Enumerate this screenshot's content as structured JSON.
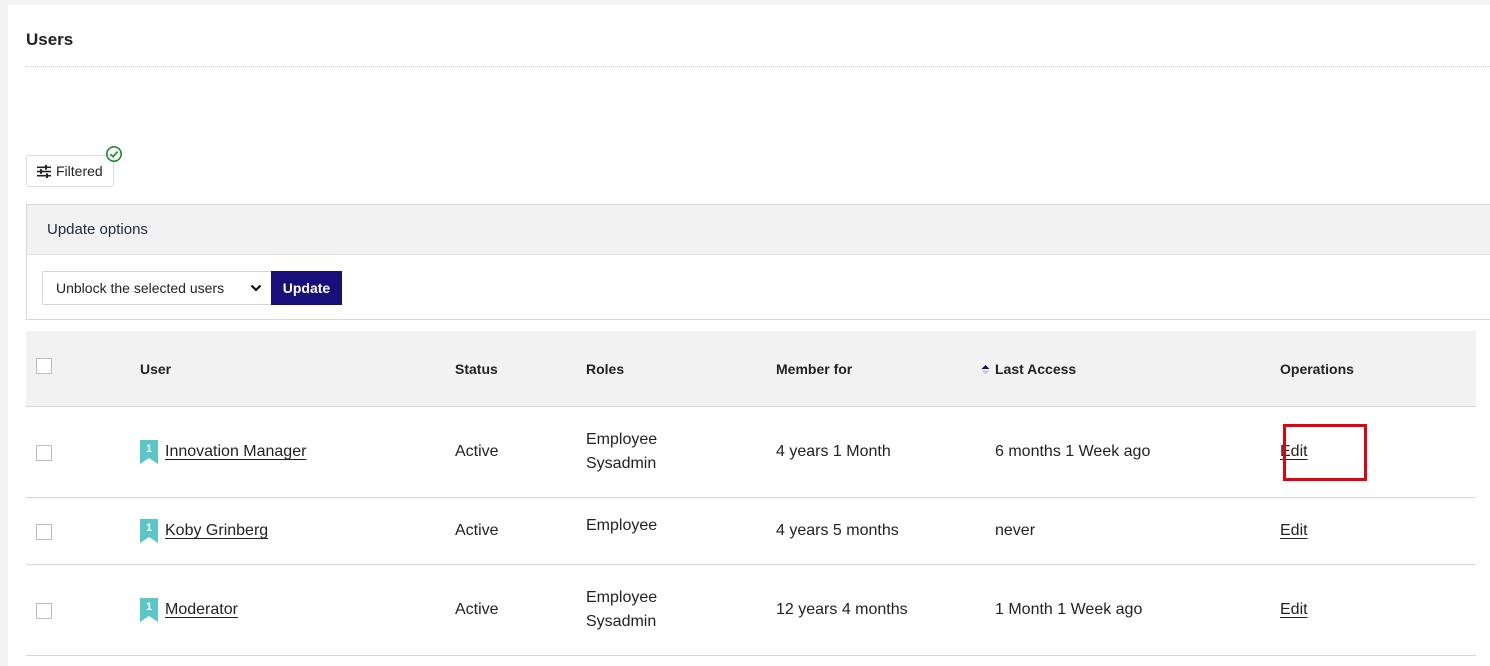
{
  "page": {
    "title": "Users"
  },
  "filter": {
    "label": "Filtered"
  },
  "update_options": {
    "heading": "Update options",
    "selected_action": "Unblock the selected users",
    "button_label": "Update"
  },
  "table": {
    "headers": {
      "user": "User",
      "status": "Status",
      "roles": "Roles",
      "member_for": "Member for",
      "last_access": "Last Access",
      "operations": "Operations"
    },
    "rows": [
      {
        "badge": "1",
        "name": "Innovation Manager",
        "status": "Active",
        "roles": [
          "Employee",
          "Sysadmin"
        ],
        "member_for": "4 years 1 Month",
        "last_access": "6 months 1 Week ago",
        "operation": "Edit"
      },
      {
        "badge": "1",
        "name": "Koby Grinberg",
        "status": "Active",
        "roles": [
          "Employee"
        ],
        "member_for": "4 years 5 months",
        "last_access": "never",
        "operation": "Edit"
      },
      {
        "badge": "1",
        "name": "Moderator",
        "status": "Active",
        "roles": [
          "Employee",
          "Sysadmin"
        ],
        "member_for": "12 years 4 months",
        "last_access": "1 Month 1 Week ago",
        "operation": "Edit"
      }
    ]
  },
  "colors": {
    "primary_button": "#17107a",
    "badge": "#5cc6c6",
    "filter_check": "#1e8a2e",
    "highlight": "#e3000f"
  },
  "icons": {
    "filter": "sliders-icon",
    "filter_status": "check-circle-icon",
    "select": "chevron-down-icon",
    "sort": "sort-icon",
    "badge": "bookmark-badge-icon"
  }
}
